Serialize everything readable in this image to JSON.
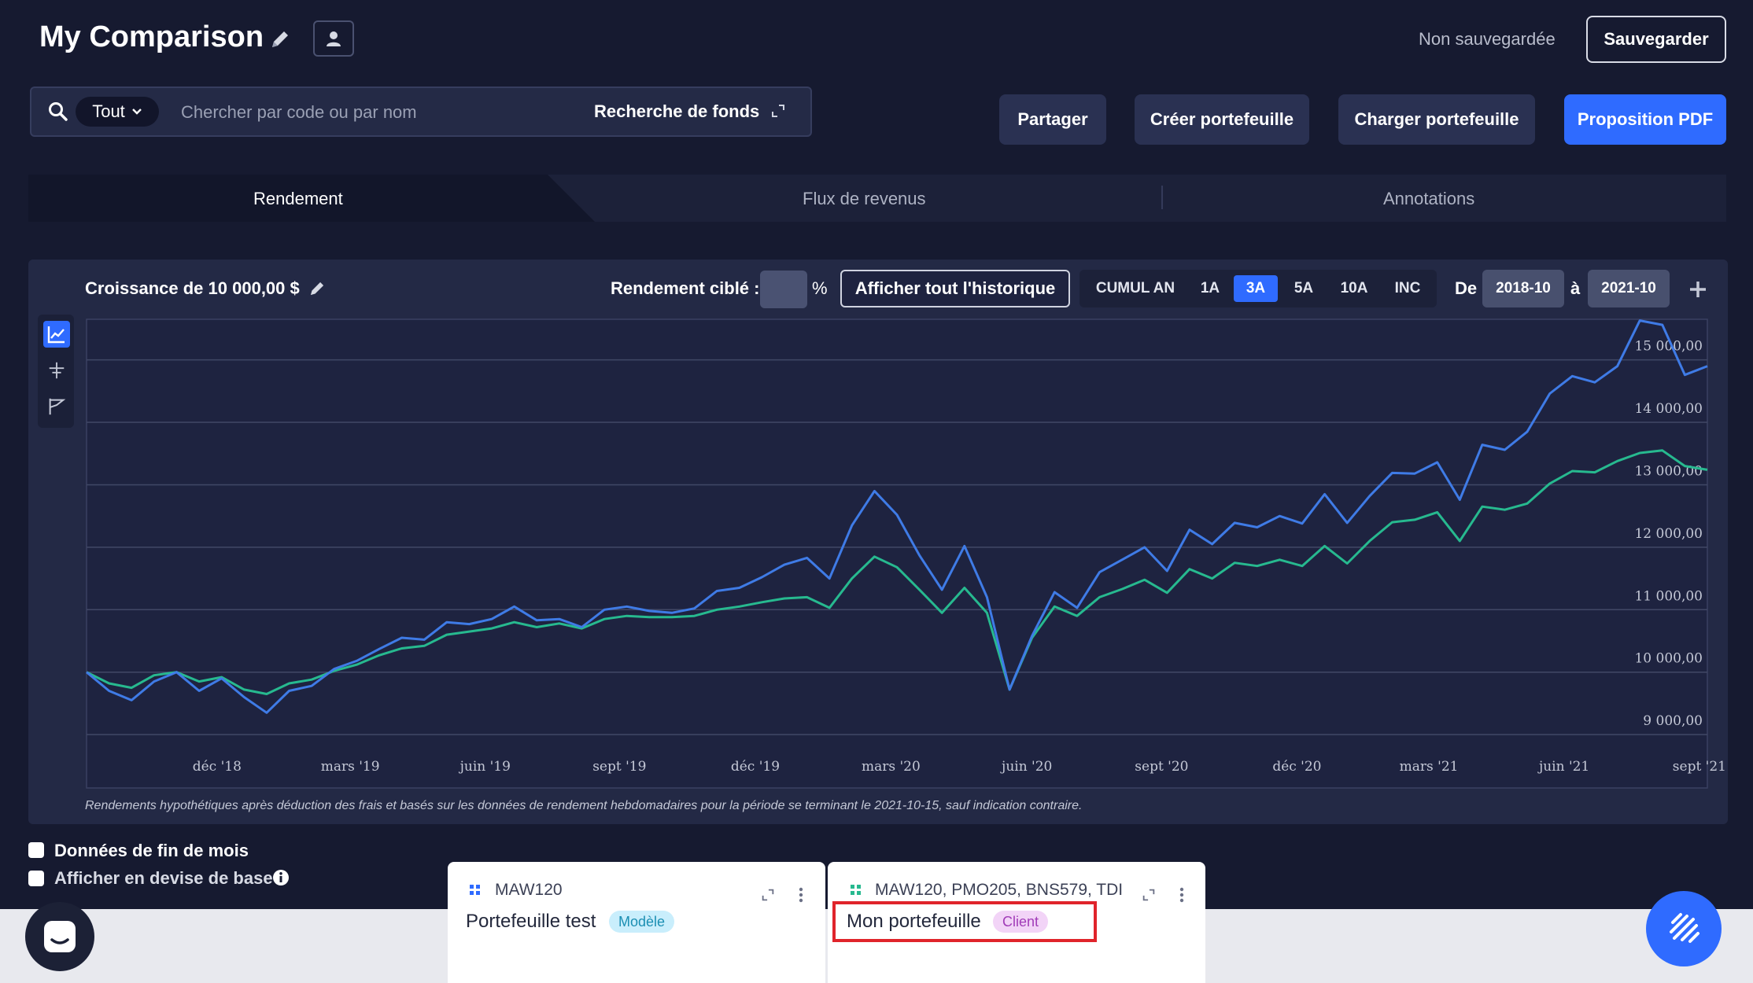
{
  "header": {
    "title": "My Comparison",
    "save_status": "Non sauvegardée",
    "save_label": "Sauvegarder"
  },
  "search": {
    "scope": "Tout",
    "placeholder": "Chercher par code ou par nom",
    "fund_search_label": "Recherche de fonds"
  },
  "actions": {
    "share": "Partager",
    "create_portfolio": "Créer portefeuille",
    "load_portfolio": "Charger portefeuille",
    "pdf_proposal": "Proposition PDF"
  },
  "tabs": [
    {
      "label": "Rendement",
      "active": true
    },
    {
      "label": "Flux de revenus",
      "active": false
    },
    {
      "label": "Annotations",
      "active": false
    }
  ],
  "controls": {
    "growth_prefix": "Croissance de",
    "growth_amount": "10 000,00 $",
    "target_label": "Rendement ciblé :",
    "target_value": "",
    "percent": "%",
    "history_label": "Afficher tout l'historique",
    "periods": [
      "CUMUL AN",
      "1A",
      "3A",
      "5A",
      "10A",
      "INC"
    ],
    "active_period": "3A",
    "from_label": "De",
    "from_date": "2018-10",
    "to_label": "à",
    "to_date": "2021-10"
  },
  "chart_data": {
    "type": "line",
    "x_tick_labels": [
      "déc '18",
      "mars '19",
      "juin '19",
      "sept '19",
      "déc '19",
      "mars '20",
      "juin '20",
      "sept '20",
      "déc '20",
      "mars '21",
      "juin '21",
      "sept '21"
    ],
    "y_tick_labels": [
      "9 000,00",
      "10 000,00",
      "11 000,00",
      "12 000,00",
      "13 000,00",
      "14 000,00",
      "15 000,00"
    ],
    "ylim": [
      8800,
      15650
    ],
    "x_range": [
      "2018-10",
      "2021-10"
    ],
    "grid": true,
    "series": [
      {
        "color": "#3f7be6",
        "values": [
          10000,
          9700,
          9550,
          9850,
          10000,
          9700,
          9900,
          9600,
          9350,
          9700,
          9780,
          10050,
          10180,
          10370,
          10550,
          10520,
          10800,
          10770,
          10850,
          11050,
          10830,
          10850,
          10720,
          11000,
          11050,
          10980,
          10950,
          11020,
          11300,
          11350,
          11520,
          11720,
          11830,
          11500,
          12350,
          12900,
          12520,
          11870,
          11320,
          12020,
          11200,
          9720,
          10580,
          11280,
          11030,
          11600,
          11800,
          12000,
          11620,
          12280,
          12050,
          12390,
          12320,
          12500,
          12380,
          12850,
          12390,
          12820,
          13190,
          13180,
          13360,
          12760,
          13640,
          13560,
          13850,
          14460,
          14740,
          14640,
          14900,
          15630,
          15560,
          14760,
          14900
        ]
      },
      {
        "color": "#27b98f",
        "values": [
          10000,
          9820,
          9750,
          9950,
          10000,
          9850,
          9920,
          9720,
          9650,
          9820,
          9880,
          10020,
          10120,
          10270,
          10380,
          10420,
          10600,
          10650,
          10700,
          10800,
          10720,
          10780,
          10700,
          10850,
          10900,
          10880,
          10880,
          10900,
          11000,
          11050,
          11120,
          11180,
          11200,
          11030,
          11500,
          11850,
          11680,
          11320,
          10950,
          11350,
          10950,
          9720,
          10550,
          11050,
          10900,
          11200,
          11330,
          11480,
          11270,
          11650,
          11500,
          11750,
          11700,
          11800,
          11700,
          12020,
          11740,
          12100,
          12400,
          12440,
          12560,
          12100,
          12650,
          12600,
          12700,
          13020,
          13220,
          13200,
          13380,
          13510,
          13550,
          13300,
          13240
        ]
      }
    ]
  },
  "disclaimer": "Rendements hypothétiques après déduction des frais et basés sur les données de rendement hebdomadaires pour la période se terminant le 2021-10-15, sauf indication contraire.",
  "options": {
    "month_end": "Données de fin de mois",
    "base_currency": "Afficher en devise de base"
  },
  "cards": [
    {
      "codes": "MAW120",
      "name": "Portefeuille test",
      "badge": "Modèle"
    },
    {
      "codes": "MAW120, PMO205, BNS579, TDI",
      "name": "Mon portefeuille",
      "badge": "Client"
    }
  ],
  "colors": {
    "background": "#161a30",
    "panel": "#232945",
    "primary": "#2f6bff",
    "series_1": "#3f7be6",
    "series_2": "#27b98f",
    "highlight": "#e0242b"
  }
}
